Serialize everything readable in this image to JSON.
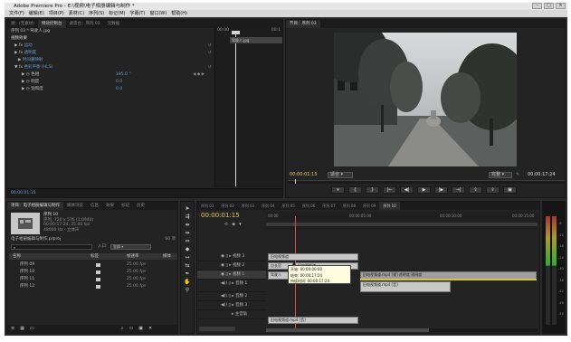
{
  "window": {
    "title": "Adobe Premiere Pro - E:\\视频\\电子相册编辑与制作 *"
  },
  "menu": [
    "文件(F)",
    "编辑(E)",
    "项目(P)",
    "素材(C)",
    "序列(S)",
    "标记(M)",
    "字幕(T)",
    "窗口(W)",
    "帮助(H)"
  ],
  "effect_controls": {
    "tabs": [
      "源：(无素材)",
      "特效控制台",
      "调音台：序列 03",
      "元数据"
    ],
    "header_clip": "序列 03 * 驾驶人.jpg",
    "ruler_start": "00:00",
    "ruler_end": "00:1",
    "clip_name_on_ruler": "驾驶人.jpg",
    "section_video": "视频效果",
    "effects": [
      {
        "name": "运动",
        "color": "#6a9ccc"
      },
      {
        "name": "透明度",
        "color": "#6a9ccc"
      },
      {
        "name": "时间重映射",
        "color": "#6a9ccc"
      },
      {
        "name": "色彩平衡 (HLS)",
        "color": "#6a9ccc"
      }
    ],
    "params": [
      {
        "name": "色相",
        "value": "185.0 °"
      },
      {
        "name": "明度",
        "value": "0.0"
      },
      {
        "name": "饱和度",
        "value": "0.0"
      }
    ],
    "current_time": "00:00:01:15"
  },
  "program_monitor": {
    "tab": "节目：序列 03",
    "timecode_left": "00:00:01:15",
    "fit": "适合",
    "quality": "完整",
    "timecode_right": "00:00:17:24"
  },
  "project": {
    "tabs": [
      "项目：电子相册编辑与制作",
      "媒体浏览",
      "信息",
      "效果",
      "标记",
      "历史"
    ],
    "sequence_name": "序列 10",
    "sequence_info": [
      "序列, 720 x 576 (1.0940)",
      "00:00:17:24, 25.00 fps",
      "48000 Hz - 立体声"
    ],
    "project_file": "电子相册编辑与制作.prproj",
    "items_count": "60 项",
    "search_label": "入口:",
    "search_value": "全部",
    "columns": [
      "名称",
      "标签",
      "帧速率",
      "媒体"
    ],
    "rows": [
      {
        "name": "序列 09",
        "fps": "25.00 fps"
      },
      {
        "name": "序列 10",
        "fps": "25.00 fps"
      },
      {
        "name": "序列 11",
        "fps": "25.00 fps"
      },
      {
        "name": "序列 12",
        "fps": "25.00 fps"
      }
    ]
  },
  "timeline": {
    "tabs": [
      "序列 01",
      "序列 02",
      "序列 03",
      "序列 04",
      "序列 05",
      "序列 06",
      "序列 07",
      "序列 08",
      "序列 09",
      "序列 10"
    ],
    "active_tab": "序列 10",
    "timecode": "00:00:01:15",
    "ruler": [
      "00:00",
      "00:00:05:00",
      "00:00:10:00",
      "00:00:15:00"
    ],
    "tracks": [
      {
        "name": "视频 3",
        "type": "video"
      },
      {
        "name": "视频 2",
        "type": "video"
      },
      {
        "name": "视频 1",
        "type": "video"
      },
      {
        "name": "音频 1",
        "type": "audio"
      },
      {
        "name": "音频 2",
        "type": "audio"
      },
      {
        "name": "音频 3",
        "type": "audio"
      },
      {
        "name": "主音轨",
        "type": "master"
      }
    ],
    "clips": {
      "v3a": "旧电视频道",
      "v2a": "旧电视频道",
      "v1a": "驾驶人",
      "v1b": "旧电视频道.mp4 [视] 透明度:透明度",
      "a1a": "旧电视频道.mp4 [音]",
      "a3a": "旧电视频道.mp4 [音]",
      "v2b": "自长官"
    },
    "tooltip": [
      "开始: 00:00:00:00",
      "结束: 00:00:17:24",
      "持续时间: 00:00:17:24"
    ]
  },
  "meters": {
    "db_labels": [
      "-6",
      "-12",
      "-18",
      "-24",
      "-30",
      "-36",
      "-42",
      "-48",
      "-54"
    ]
  }
}
